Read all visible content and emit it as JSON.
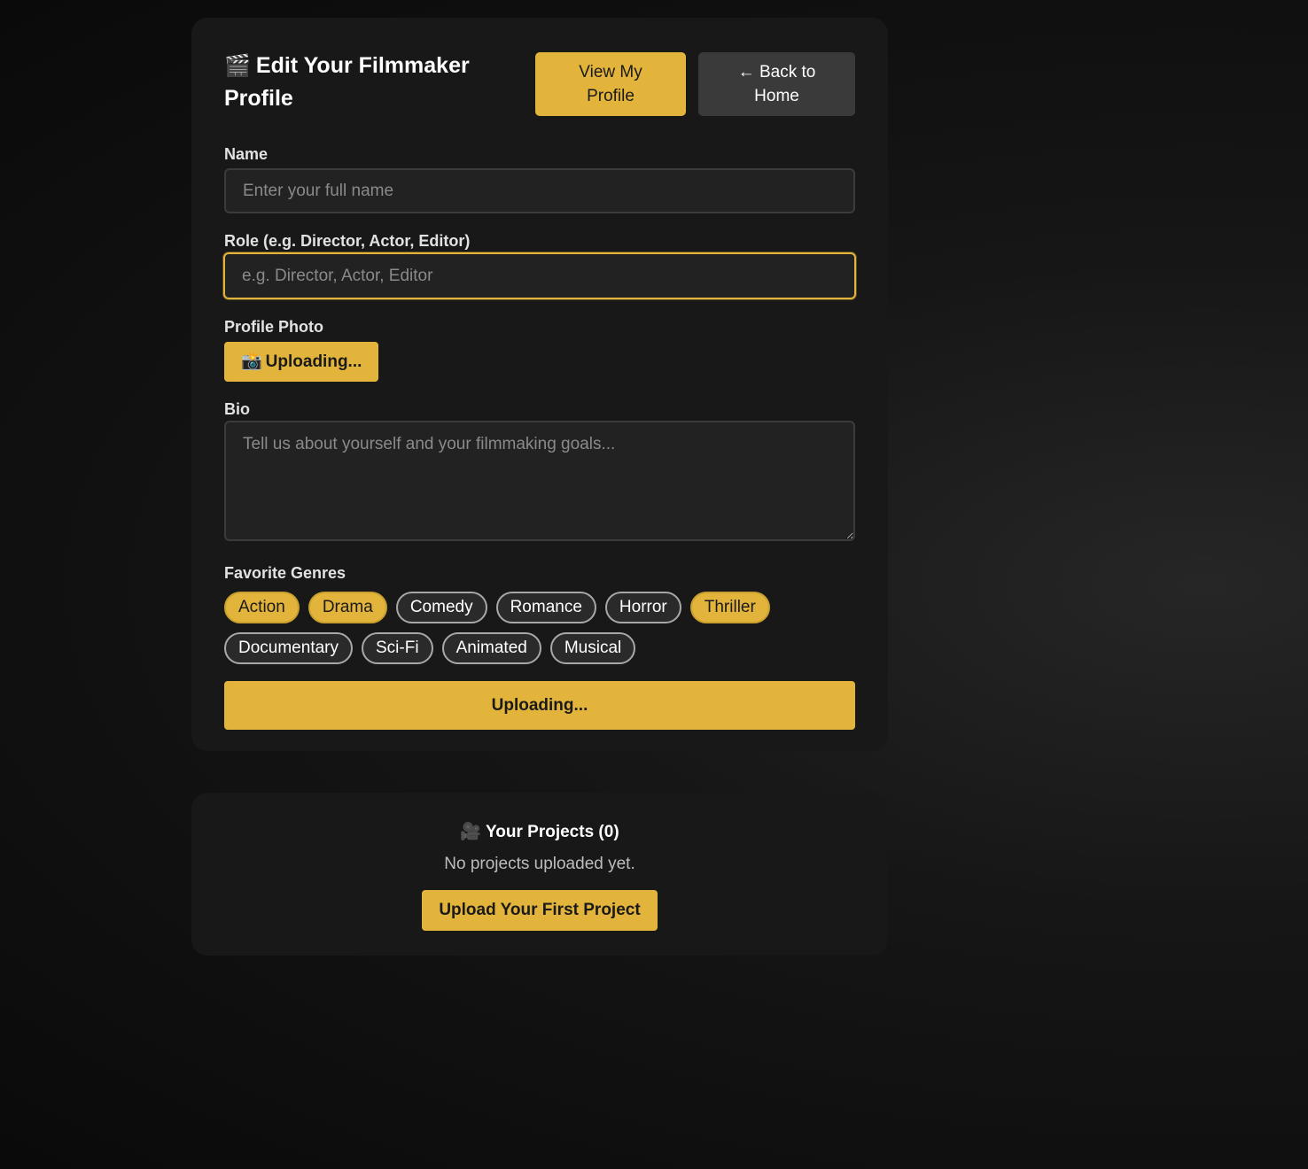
{
  "edit_form": {
    "title_icon": "🎬",
    "title": "Edit Your Filmmaker Profile",
    "view_profile_label": "View My Profile",
    "back_home_label": "← Back to Home",
    "name": {
      "label": "Name",
      "placeholder": "Enter your full name",
      "value": ""
    },
    "role": {
      "label": "Role (e.g. Director, Actor, Editor)",
      "placeholder": "e.g. Director, Actor, Editor",
      "value": ""
    },
    "photo": {
      "label": "Profile Photo",
      "button_icon": "📸",
      "button_label": "Uploading..."
    },
    "bio": {
      "label": "Bio",
      "placeholder": "Tell us about yourself and your filmmaking goals...",
      "value": ""
    },
    "genres": {
      "label": "Favorite Genres",
      "items": [
        {
          "label": "Action",
          "selected": true
        },
        {
          "label": "Drama",
          "selected": true
        },
        {
          "label": "Comedy",
          "selected": false
        },
        {
          "label": "Romance",
          "selected": false
        },
        {
          "label": "Horror",
          "selected": false
        },
        {
          "label": "Thriller",
          "selected": true
        },
        {
          "label": "Documentary",
          "selected": false
        },
        {
          "label": "Sci-Fi",
          "selected": false
        },
        {
          "label": "Animated",
          "selected": false
        },
        {
          "label": "Musical",
          "selected": false
        }
      ]
    },
    "submit_label": "Uploading..."
  },
  "projects": {
    "title_icon": "🎥",
    "title": "Your Projects (0)",
    "empty_text": "No projects uploaded yet.",
    "upload_label": "Upload Your First Project"
  },
  "colors": {
    "accent": "#e3b43c",
    "card_bg": "#181818",
    "input_bg": "#222222",
    "secondary_button": "#3a3a3a"
  }
}
